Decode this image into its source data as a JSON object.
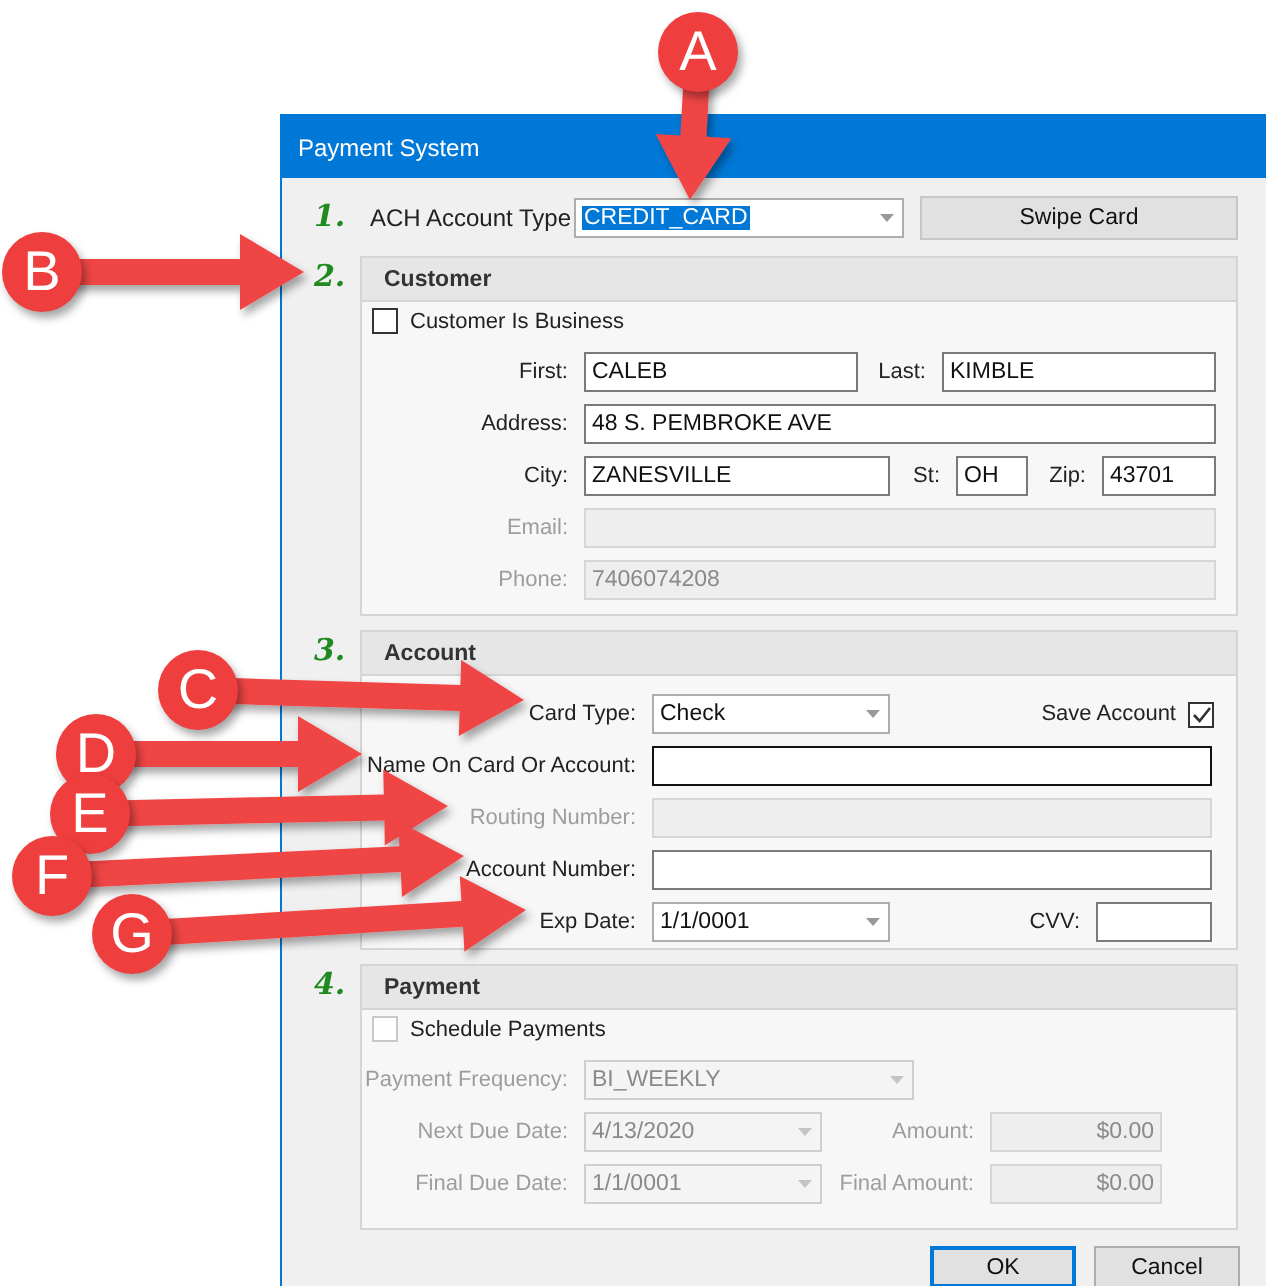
{
  "window": {
    "title": "Payment System"
  },
  "account_type": {
    "step": "1.",
    "label": "ACH Account Type",
    "value": "CREDIT_CARD",
    "text_selected": true
  },
  "swipe_button": {
    "label": "Swipe Card"
  },
  "sections": [
    {
      "step": "2.",
      "title": "Customer",
      "rows": [
        [
          {
            "kind": "checkbox",
            "label": "Customer Is Business",
            "checked": false,
            "disabled": false
          }
        ],
        [
          {
            "kind": "field",
            "label": "First:",
            "value": "CALEB",
            "disabled": false,
            "focused": false
          },
          {
            "kind": "field",
            "label": "Last:",
            "value": "KIMBLE",
            "disabled": false,
            "focused": false
          }
        ],
        [
          {
            "kind": "field",
            "label": "Address:",
            "value": "48 S. PEMBROKE AVE",
            "disabled": false,
            "focused": false
          }
        ],
        [
          {
            "kind": "field",
            "label": "City:",
            "value": "ZANESVILLE",
            "disabled": false,
            "focused": false
          },
          {
            "kind": "field",
            "label": "St:",
            "value": "OH",
            "disabled": false,
            "focused": false
          },
          {
            "kind": "field",
            "label": "Zip:",
            "value": "43701",
            "disabled": false,
            "focused": false
          }
        ],
        [
          {
            "kind": "field",
            "label": "Email:",
            "disabled": true,
            "focused": false
          }
        ],
        [
          {
            "kind": "field",
            "label": "Phone:",
            "value": "7406074208",
            "disabled": true,
            "focused": false
          }
        ]
      ]
    },
    {
      "step": "3.",
      "title": "Account",
      "rows": [
        [
          {
            "kind": "dropdown",
            "label": "Card Type:",
            "value": "Check",
            "disabled": false
          },
          {
            "kind": "trailing_checkbox",
            "label": "Save Account",
            "checked": true,
            "disabled": false
          }
        ],
        [
          {
            "kind": "field",
            "label": "Name On Card Or Account:",
            "disabled": false,
            "focused": true
          }
        ],
        [
          {
            "kind": "field",
            "label": "Routing Number:",
            "disabled": true,
            "focused": false
          }
        ],
        [
          {
            "kind": "field",
            "label": "Account Number:",
            "disabled": false,
            "focused": false
          }
        ],
        [
          {
            "kind": "dropdown",
            "label": "Exp Date:",
            "value": "1/1/0001",
            "disabled": false
          },
          {
            "kind": "field",
            "label": "CVV:",
            "disabled": false,
            "focused": false
          }
        ]
      ]
    },
    {
      "step": "4.",
      "title": "Payment",
      "rows": [
        [
          {
            "kind": "checkbox",
            "label": "Schedule Payments",
            "checked": false,
            "disabled": false
          }
        ],
        [
          {
            "kind": "dropdown",
            "label": "Payment Frequency:",
            "value": "BI_WEEKLY",
            "disabled": true
          }
        ],
        [
          {
            "kind": "dropdown",
            "label": "Next Due Date:",
            "value": "4/13/2020",
            "disabled": true
          },
          {
            "kind": "amount",
            "label": "Amount:",
            "value": "$0.00",
            "disabled": true
          }
        ],
        [
          {
            "kind": "dropdown",
            "label": "Final Due Date:",
            "value": "1/1/0001",
            "disabled": true
          },
          {
            "kind": "amount",
            "label": "Final Amount:",
            "value": "$0.00",
            "disabled": true
          }
        ]
      ]
    }
  ],
  "buttons": [
    {
      "label": "OK",
      "default": true
    },
    {
      "label": "Cancel",
      "default": false
    }
  ],
  "callouts": [
    {
      "letter": "A"
    },
    {
      "letter": "B"
    },
    {
      "letter": "C"
    },
    {
      "letter": "D"
    },
    {
      "letter": "E"
    },
    {
      "letter": "F"
    },
    {
      "letter": "G"
    }
  ]
}
